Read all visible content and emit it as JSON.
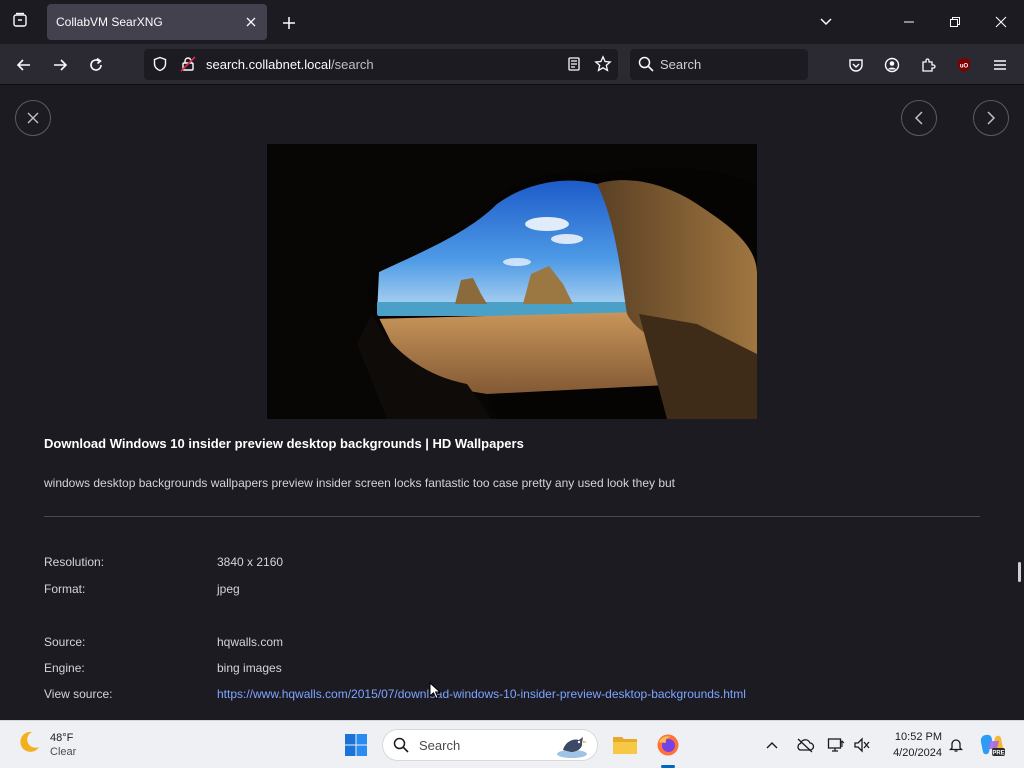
{
  "browser": {
    "tab": {
      "title": "CollabVM SearXNG"
    },
    "url": {
      "host": "search.collabnet.local",
      "path": "/search"
    },
    "search": {
      "placeholder": "Search"
    }
  },
  "viewer": {
    "title": "Download Windows 10 insider preview desktop backgrounds | HD Wallpapers",
    "description": "windows desktop backgrounds wallpapers preview insider screen locks fantastic too case pretty any used look they but",
    "meta": {
      "resolution_label": "Resolution:",
      "resolution_value": "3840 x 2160",
      "format_label": "Format:",
      "format_value": "jpeg",
      "source_label": "Source:",
      "source_value": "hqwalls.com",
      "engine_label": "Engine:",
      "engine_value": "bing images",
      "view_source_label": "View source:",
      "view_source_url": "https://www.hqwalls.com/2015/07/download-windows-10-insider-preview-desktop-backgrounds.html"
    }
  },
  "taskbar": {
    "weather": {
      "temp": "48°F",
      "condition": "Clear"
    },
    "search_label": "Search",
    "clock": {
      "time": "10:52 PM",
      "date": "4/20/2024"
    }
  },
  "colors": {
    "accent": "#7fa4ff",
    "background": "#1c1b22",
    "toolbar": "#2b2a33"
  }
}
